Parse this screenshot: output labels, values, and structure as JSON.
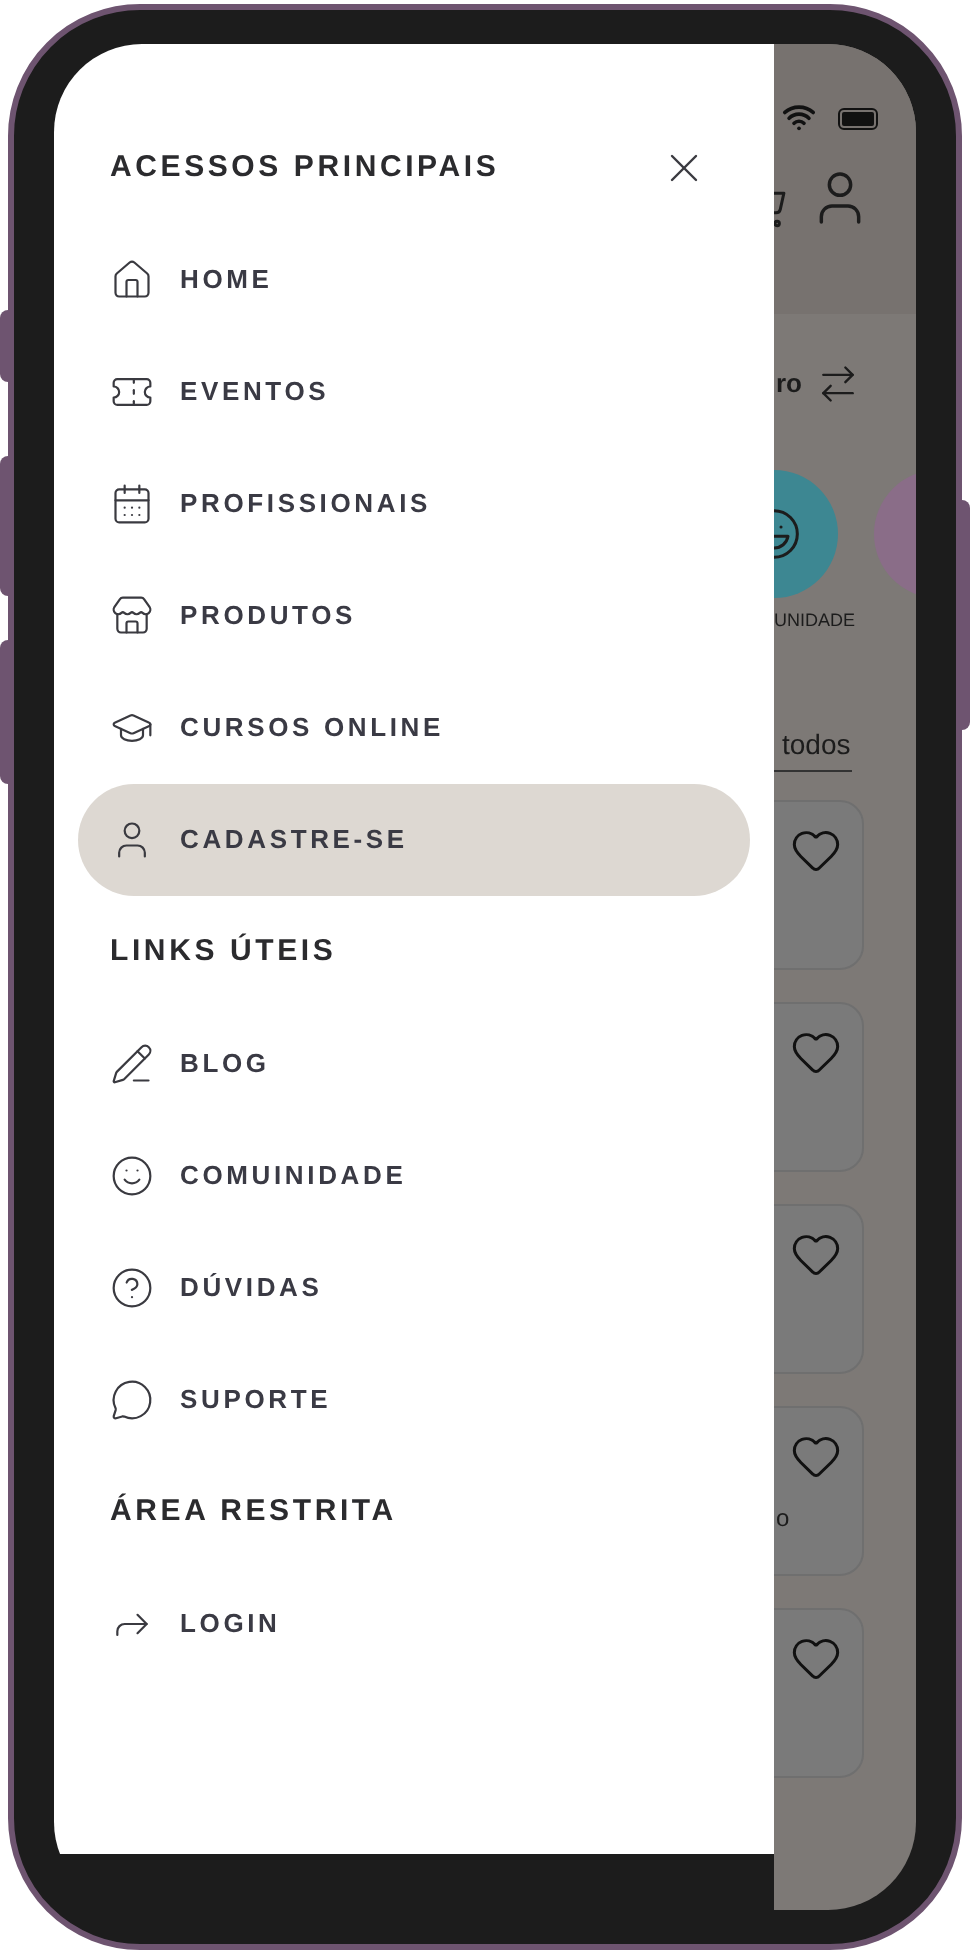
{
  "menu": {
    "sections": [
      {
        "title": "ACESSOS PRINCIPAIS",
        "items": [
          {
            "label": "HOME",
            "selected": false
          },
          {
            "label": "EVENTOS",
            "selected": false
          },
          {
            "label": "PROFISSIONAIS",
            "selected": false
          },
          {
            "label": "PRODUTOS",
            "selected": false
          },
          {
            "label": "CURSOS ONLINE",
            "selected": false
          },
          {
            "label": "CADASTRE-SE",
            "selected": true
          }
        ]
      },
      {
        "title": "LINKS ÚTEIS",
        "items": [
          {
            "label": "BLOG",
            "selected": false
          },
          {
            "label": "COMUINIDADE",
            "selected": false
          },
          {
            "label": "DÚVIDAS",
            "selected": false
          },
          {
            "label": "SUPORTE",
            "selected": false
          }
        ]
      },
      {
        "title": "ÁREA RESTRITA",
        "items": [
          {
            "label": "LOGIN",
            "selected": false
          }
        ]
      }
    ]
  },
  "background_app": {
    "location_label": "ro",
    "category_label": "UNIDADE",
    "see_all_link": "todos",
    "cards": [
      {
        "favorite": false
      },
      {
        "favorite": false
      },
      {
        "favorite": false
      },
      {
        "favorite": false,
        "text": "o"
      },
      {
        "favorite": false
      }
    ]
  }
}
